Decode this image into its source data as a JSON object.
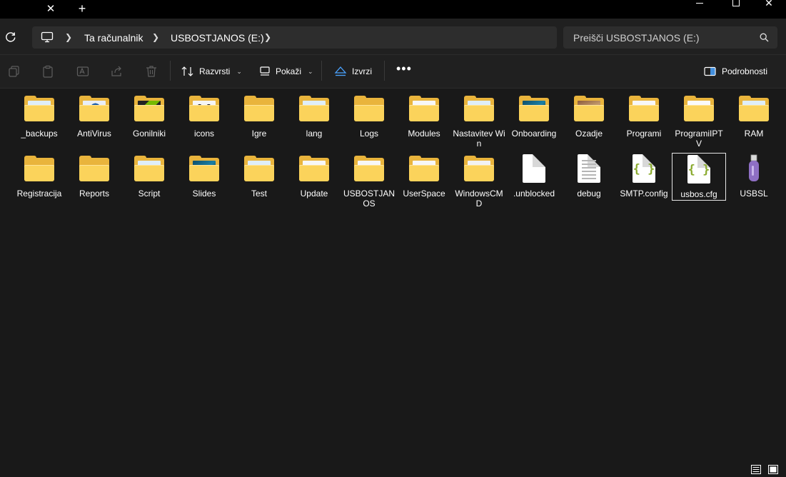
{
  "window": {
    "tab_close_glyph": "✕",
    "new_tab_glyph": "+",
    "close_glyph": "✕"
  },
  "address": {
    "crumbs": [
      "Ta računalnik",
      "USBOSTJANOS (E:)"
    ],
    "search_placeholder": "Preišči USBOSTJANOS (E:)"
  },
  "toolbar": {
    "sort_label": "Razvrsti",
    "view_label": "Pokaži",
    "eject_label": "Izvrzi",
    "more_label": "•••",
    "details_label": "Podrobnosti"
  },
  "colors": {
    "background": "#191919",
    "folder_back": "#e9b43c",
    "folder_front": "#fbd35b",
    "config_brace": "#8aaa2e"
  },
  "items": [
    {
      "label": "_backups",
      "kind": "folder",
      "content": "image"
    },
    {
      "label": "AntiVirus",
      "kind": "folder",
      "content": "shield-logo"
    },
    {
      "label": "Gonilniki",
      "kind": "folder",
      "content": "green-logo"
    },
    {
      "label": "icons",
      "kind": "folder",
      "content": "panda"
    },
    {
      "label": "Igre",
      "kind": "folder",
      "content": "empty"
    },
    {
      "label": "lang",
      "kind": "folder",
      "content": "image"
    },
    {
      "label": "Logs",
      "kind": "folder",
      "content": "empty"
    },
    {
      "label": "Modules",
      "kind": "folder",
      "content": "document"
    },
    {
      "label": "Nastavitev Win",
      "kind": "folder",
      "content": "image"
    },
    {
      "label": "Onboarding",
      "kind": "folder",
      "content": "dark-image"
    },
    {
      "label": "Ozadje",
      "kind": "folder",
      "content": "photo"
    },
    {
      "label": "Programi",
      "kind": "folder",
      "content": "document"
    },
    {
      "label": "ProgramiIPTV",
      "kind": "folder",
      "content": "face"
    },
    {
      "label": "RAM",
      "kind": "folder",
      "content": "image"
    },
    {
      "label": "Registracija",
      "kind": "folder",
      "content": "empty"
    },
    {
      "label": "Reports",
      "kind": "folder",
      "content": "empty"
    },
    {
      "label": "Script",
      "kind": "folder",
      "content": "image"
    },
    {
      "label": "Slides",
      "kind": "folder",
      "content": "dark-image"
    },
    {
      "label": "Test",
      "kind": "folder",
      "content": "image"
    },
    {
      "label": "Update",
      "kind": "folder",
      "content": "document"
    },
    {
      "label": "USBOSTJANOS",
      "kind": "folder",
      "content": "document"
    },
    {
      "label": "UserSpace",
      "kind": "folder",
      "content": "document"
    },
    {
      "label": "WindowsCMD",
      "kind": "folder",
      "content": "window"
    },
    {
      "label": ".unblocked",
      "kind": "blank-file",
      "content": ""
    },
    {
      "label": "debug",
      "kind": "text-file",
      "content": ""
    },
    {
      "label": "SMTP.config",
      "kind": "config-file",
      "content": "{ }"
    },
    {
      "label": "usbos.cfg",
      "kind": "config-file",
      "content": "{ }",
      "selected": true
    },
    {
      "label": "USBSL",
      "kind": "usb-app",
      "content": ""
    }
  ]
}
